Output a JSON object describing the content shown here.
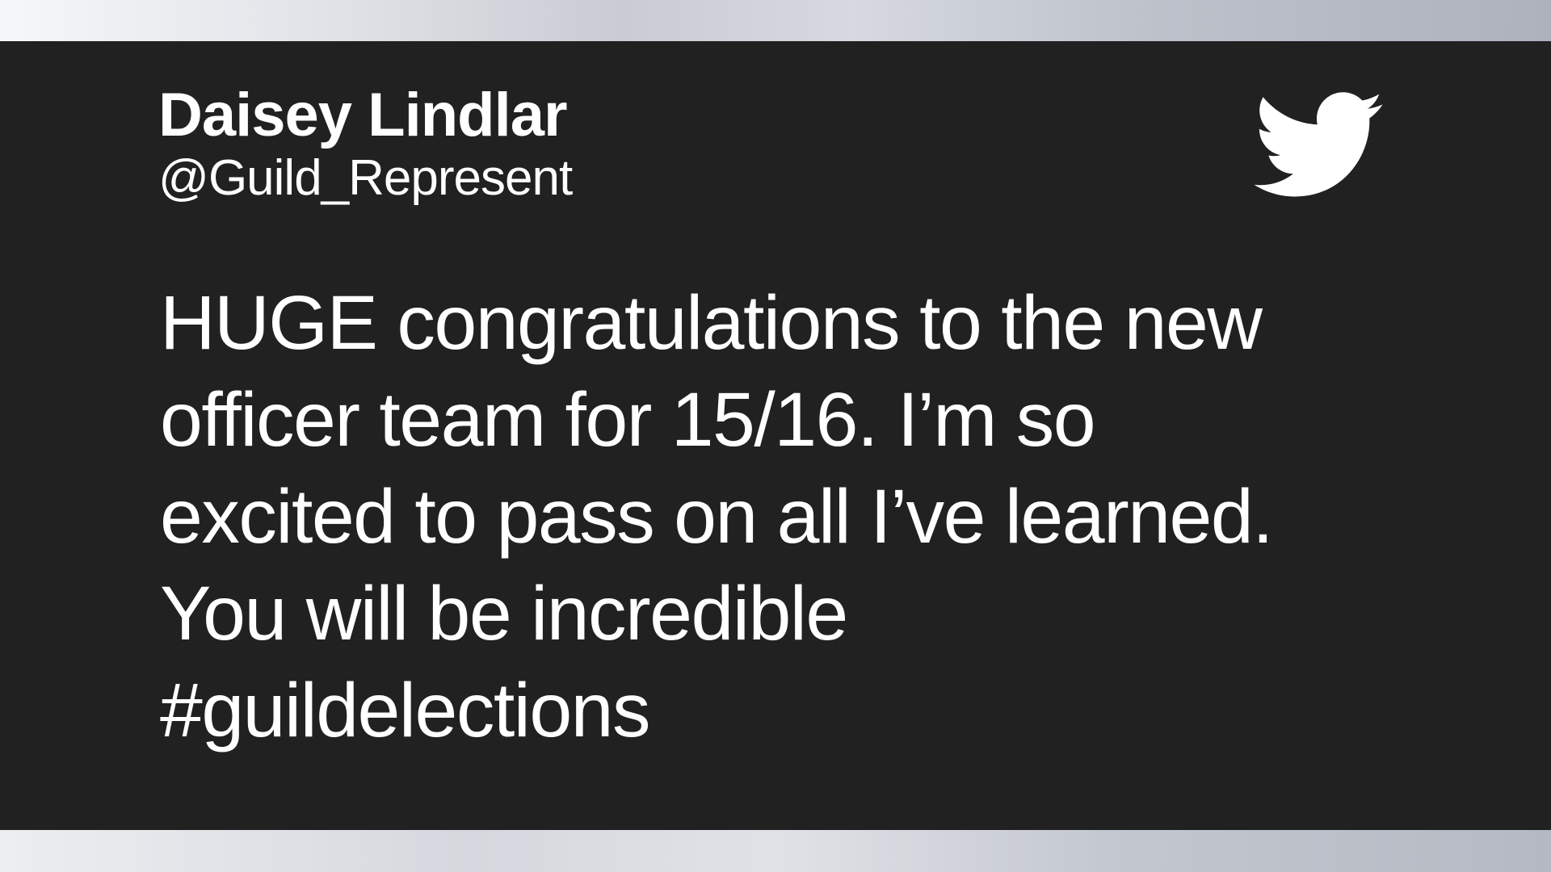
{
  "tweet": {
    "author_name": "Daisey Lindlar",
    "author_handle": "@Guild_Represent",
    "text": "HUGE congratulations to the new\nofficer team for 15/16. I’m so\nexcited to pass on all I’ve learned.\nYou will be incredible\n#guildelections",
    "icon": "twitter-bird-icon"
  },
  "colors": {
    "card_background": "#212121",
    "text": "#ffffff",
    "page_background": "#d0d3d9"
  }
}
